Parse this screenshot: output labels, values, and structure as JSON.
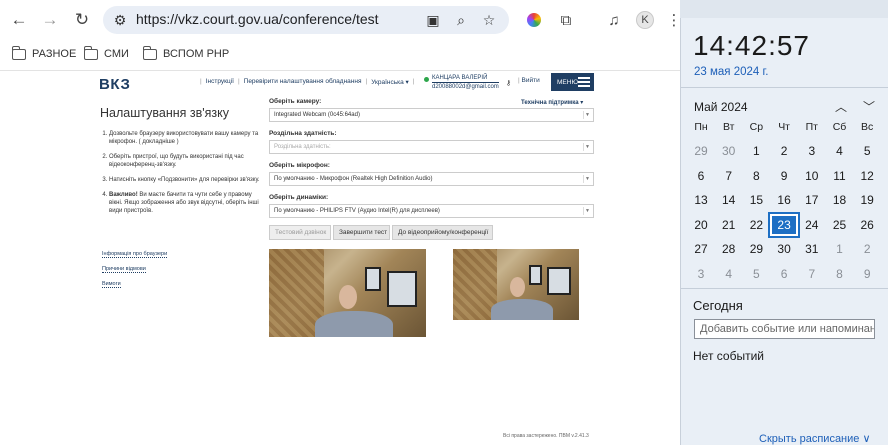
{
  "browser": {
    "url": "https://vkz.court.gov.ua/conference/test",
    "profile_initial": "K",
    "bookmarks": [
      "РАЗНОЕ",
      "СМИ",
      "ВСПОМ PHP"
    ]
  },
  "site": {
    "logo": "ВКЗ",
    "nav": [
      "Інструкції",
      "Перевірити налаштування обладнання",
      "Українська ▾"
    ],
    "user_name": "КАНЦАРА ВАЛЕРІЙ",
    "user_email": "d20088002d@gmail.com",
    "logout": "Вийти",
    "menu": "МЕНЮ"
  },
  "page": {
    "title": "Налаштування зв'язку",
    "steps": [
      "Дозвольте браузеру використовувати вашу камеру та мікрофон. ( докладніше )",
      "Оберіть пристрої, що будуть використані під час відеоконференц-зв'язку.",
      "Натисніть кнопку «Подзвонити» для перевірки зв'язку."
    ],
    "warning_label": "Важливо!",
    "warning_text": " Ви маєте бачити та чути себе у правому вікні. Якщо зображення або звук відсутні, оберіть інші види пристроїв.",
    "side_links": [
      "Інформація про браузери",
      "Причини відмови",
      "Вимоги"
    ],
    "support": "Технічна підтримка ▾",
    "camera_label": "Оберіть камеру:",
    "camera_value": "Integrated Webcam (0c45:64ad)",
    "resolution_label": "Роздільна здатність:",
    "resolution_value": "Роздільна здатність:",
    "mic_label": "Оберіть мікрофон:",
    "mic_value": "По умолчанию - Микрофон (Realtek High Definition Audio)",
    "speaker_label": "Оберіть динаміки:",
    "speaker_value": "По умолчанию - PHILIPS FTV (Аудио Intel(R) для дисплеев)",
    "buttons": [
      "Тестовий дзвінок",
      "Завершити тест",
      "До відеоприйому/конференції"
    ],
    "footer": "Всі права застережено. ПВМ v.2.41.3"
  },
  "calendar": {
    "time": "14:42:57",
    "date": "23 мая 2024 г.",
    "month": "Май 2024",
    "weekdays": [
      "Пн",
      "Вт",
      "Ср",
      "Чт",
      "Пт",
      "Сб",
      "Вс"
    ],
    "weeks": [
      [
        "29",
        "30",
        "1",
        "2",
        "3",
        "4",
        "5"
      ],
      [
        "6",
        "7",
        "8",
        "9",
        "10",
        "11",
        "12"
      ],
      [
        "13",
        "14",
        "15",
        "16",
        "17",
        "18",
        "19"
      ],
      [
        "20",
        "21",
        "22",
        "23",
        "24",
        "25",
        "26"
      ],
      [
        "27",
        "28",
        "29",
        "30",
        "31",
        "1",
        "2"
      ],
      [
        "3",
        "4",
        "5",
        "6",
        "7",
        "8",
        "9"
      ]
    ],
    "today_label": "Сегодня",
    "event_placeholder": "Добавить событие или напоминание",
    "no_events": "Нет событий",
    "hide_schedule": "Скрыть расписание ∨",
    "accent": "#1d6fc4"
  }
}
